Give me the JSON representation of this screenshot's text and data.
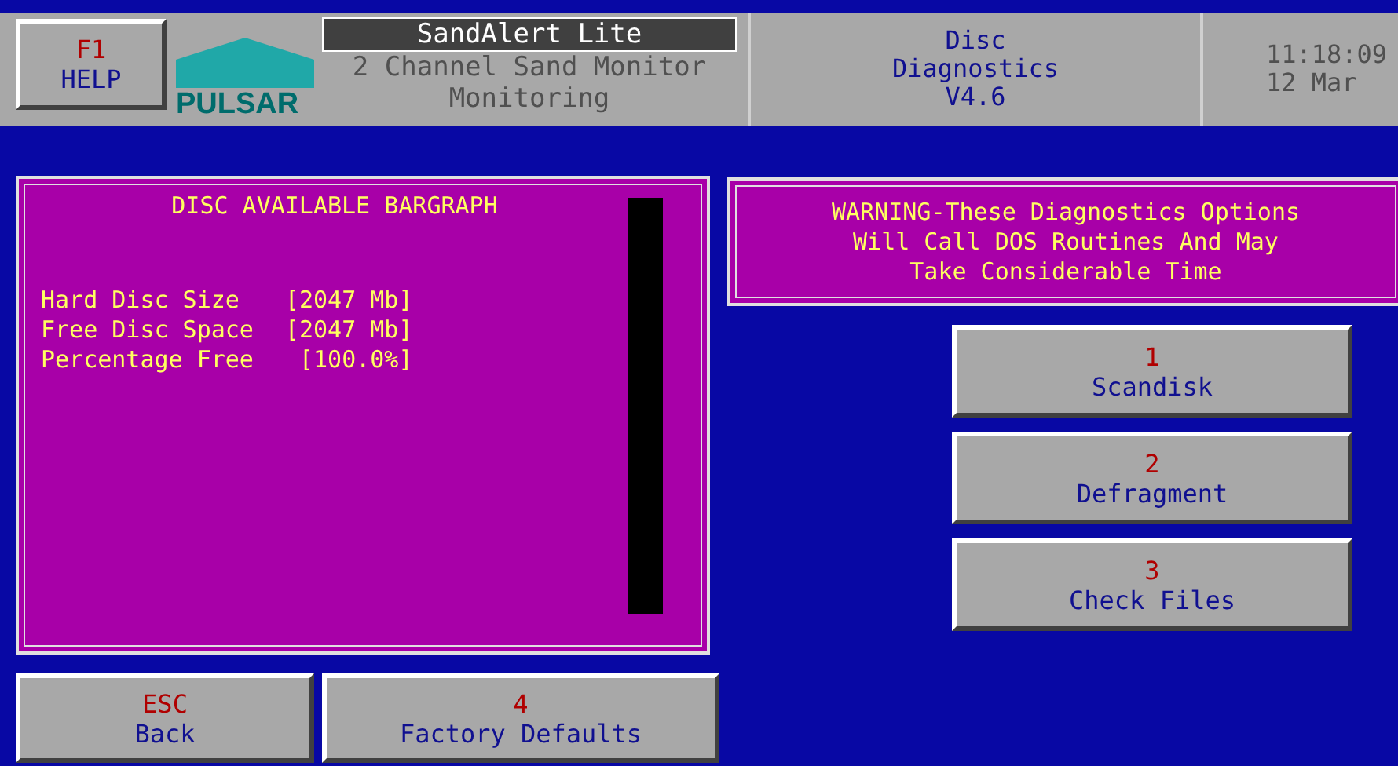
{
  "header": {
    "help_button": {
      "key": "F1",
      "label": "HELP"
    },
    "logo": "PULSAR",
    "product": "SandAlert Lite",
    "subtitle": "2 Channel Sand Monitor",
    "mode": "Monitoring",
    "screen_title": [
      "Disc",
      "Diagnostics",
      "V4.6"
    ],
    "time": "11:18:09",
    "date": "12 Mar"
  },
  "bargraph_panel": {
    "title": "DISC AVAILABLE BARGRAPH",
    "rows": [
      {
        "label": "Hard Disc Size",
        "value": "[2047 Mb]"
      },
      {
        "label": "Free Disc Space",
        "value": "[2047 Mb]"
      },
      {
        "label": "Percentage Free",
        "value": "[100.0%]"
      }
    ]
  },
  "warning": "WARNING-These Diagnostics Options Will Call DOS Routines And May Take Considerable Time",
  "actions": [
    {
      "key": "1",
      "label": "Scandisk"
    },
    {
      "key": "2",
      "label": "Defragment"
    },
    {
      "key": "3",
      "label": "Check Files"
    }
  ],
  "bottom_buttons": [
    {
      "key": "ESC",
      "label": "Back"
    },
    {
      "key": "4",
      "label": "Factory Defaults"
    }
  ]
}
